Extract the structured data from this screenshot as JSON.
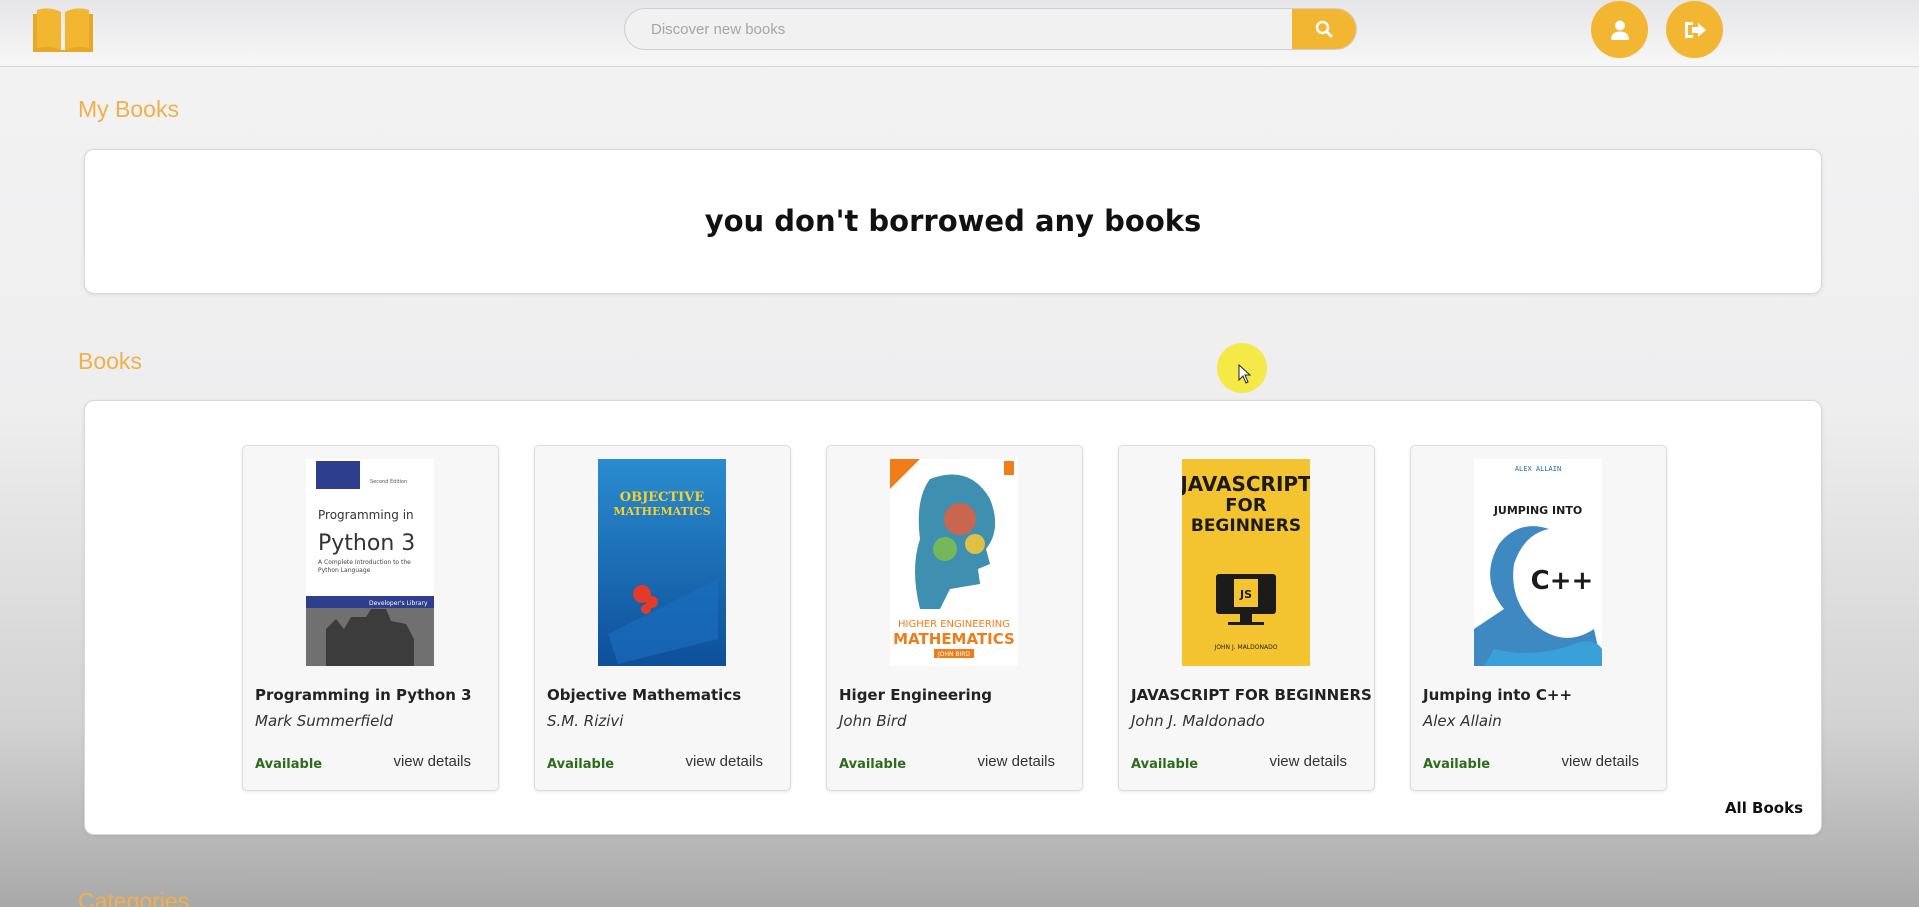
{
  "header": {
    "search_placeholder": "Discover new books"
  },
  "sections": {
    "my_books_title": "My Books",
    "books_title": "Books",
    "categories_title": "Categories"
  },
  "my_books": {
    "empty_message": "you don't borrowed any books"
  },
  "books": [
    {
      "title": "Programming in Python 3",
      "author": "Mark Summerfield",
      "status": "Available",
      "action": "view details",
      "cover": {
        "line1": "Programming in",
        "line2": "Python 3",
        "sub": "A Complete Introduction to the Python Language",
        "series": "Developer's Library",
        "edition": "Second Edition"
      }
    },
    {
      "title": "Objective Mathematics",
      "author": "S.M. Rizivi",
      "status": "Available",
      "action": "view details",
      "cover": {
        "line1": "OBJECTIVE",
        "line2": "MATHEMATICS"
      }
    },
    {
      "title": "Higer Engineering",
      "author": "John Bird",
      "status": "Available",
      "action": "view details",
      "cover": {
        "line1": "HIGHER ENGINEERING",
        "line2": "MATHEMATICS",
        "author": "JOHN BIRD"
      }
    },
    {
      "title": "JAVASCRIPT FOR BEGINNERS",
      "author": "John J. Maldonado",
      "status": "Available",
      "action": "view details",
      "cover": {
        "line1": "JAVASCRIPT",
        "line2": "FOR",
        "line3": "BEGINNERS",
        "author": "JOHN J. MALDONADO",
        "badge": "JS"
      }
    },
    {
      "title": "Jumping into C++",
      "author": "Alex Allain",
      "status": "Available",
      "action": "view details",
      "cover": {
        "author": "ALEX ALLAIN",
        "line1": "JUMPING INTO",
        "line2": "C++"
      }
    }
  ],
  "all_books_link": "All Books",
  "colors": {
    "accent": "#f2b632",
    "section_title": "#f0b04a",
    "available": "#2e6b1e"
  },
  "icons": {
    "logo": "open-book-icon",
    "search": "search-icon",
    "profile": "user-icon",
    "logout": "logout-icon"
  }
}
